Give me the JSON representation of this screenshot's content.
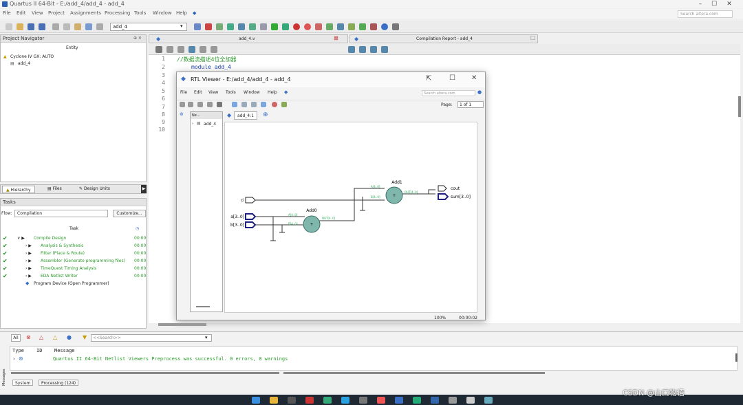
{
  "window": {
    "title": "Quartus II 64-Bit - E:/add_4/add_4 - add_4"
  },
  "menu": [
    "File",
    "Edit",
    "View",
    "Project",
    "Assignments",
    "Processing",
    "Tools",
    "Window",
    "Help"
  ],
  "search_placeholder": "Search altera.com",
  "toolbar": {
    "entity": "add_4"
  },
  "project_navigator": {
    "title": "Project Navigator",
    "col": "Entity",
    "device": "Cyclone IV GX: AUTO",
    "top": "add_4"
  },
  "nav_tabs": [
    "Hierarchy",
    "Files",
    "Design Units"
  ],
  "tasks": {
    "title": "Tasks",
    "flow_label": "Flow:",
    "flow_value": "Compilation",
    "customize": "Customize...",
    "col_task": "Task",
    "items": [
      {
        "name": "Compile Design",
        "time": "00:00"
      },
      {
        "name": "Analysis & Synthesis",
        "time": "00:00"
      },
      {
        "name": "Fitter (Place & Route)",
        "time": "00:00"
      },
      {
        "name": "Assembler (Generate programming files)",
        "time": "00:00"
      },
      {
        "name": "TimeQuest Timing Analysis",
        "time": "00:00"
      },
      {
        "name": "EDA Netlist Writer",
        "time": "00:00"
      },
      {
        "name": "Program Device (Open Programmer)",
        "time": ""
      }
    ]
  },
  "editor": {
    "tab": "add_4.v",
    "report_tab": "Compilation Report - add_4",
    "lines": [
      "1",
      "2",
      "3",
      "4",
      "5",
      "6",
      "7",
      "8",
      "9",
      "10"
    ],
    "line1": "//数据流描述4位全加器",
    "line2": "module add_4"
  },
  "rtl": {
    "title": "RTL Viewer - E:/add_4/add_4 - add_4",
    "menu": [
      "File",
      "Edit",
      "View",
      "Tools",
      "Window",
      "Help"
    ],
    "search": "Search altera.com",
    "page_label": "Page:",
    "page_value": "1 of 1",
    "tree_header": "Ne...",
    "tree_item": "add_4",
    "tab": "add_4:1",
    "zoom": "100%",
    "time": "00:00:02",
    "nodes": {
      "add0": "Add0",
      "add1": "Add1",
      "ci": "ci",
      "a": "a[3..0]",
      "b": "b[3..0]",
      "cout": "cout",
      "sum": "sum[3..0]",
      "a40": "A[4..0]",
      "b40": "B[4..0]",
      "out40": "OUT[4..0]",
      "plus": "+"
    }
  },
  "messages": {
    "filter_all": "All",
    "search_placeholder": "<<Search>>",
    "col_type": "Type",
    "col_id": "ID",
    "col_message": "Message",
    "text": "Quartus II 64-Bit Netlist Viewers Preprocess was successful. 0 errors, 0 warnings",
    "side_label": "Messages",
    "tabs": [
      "System",
      "Processing (124)"
    ]
  },
  "watermark": "CSDN @山口物语",
  "colors": {
    "node": "#7fb7ad",
    "port": "#202080",
    "task_green": "#2a9a2a"
  }
}
